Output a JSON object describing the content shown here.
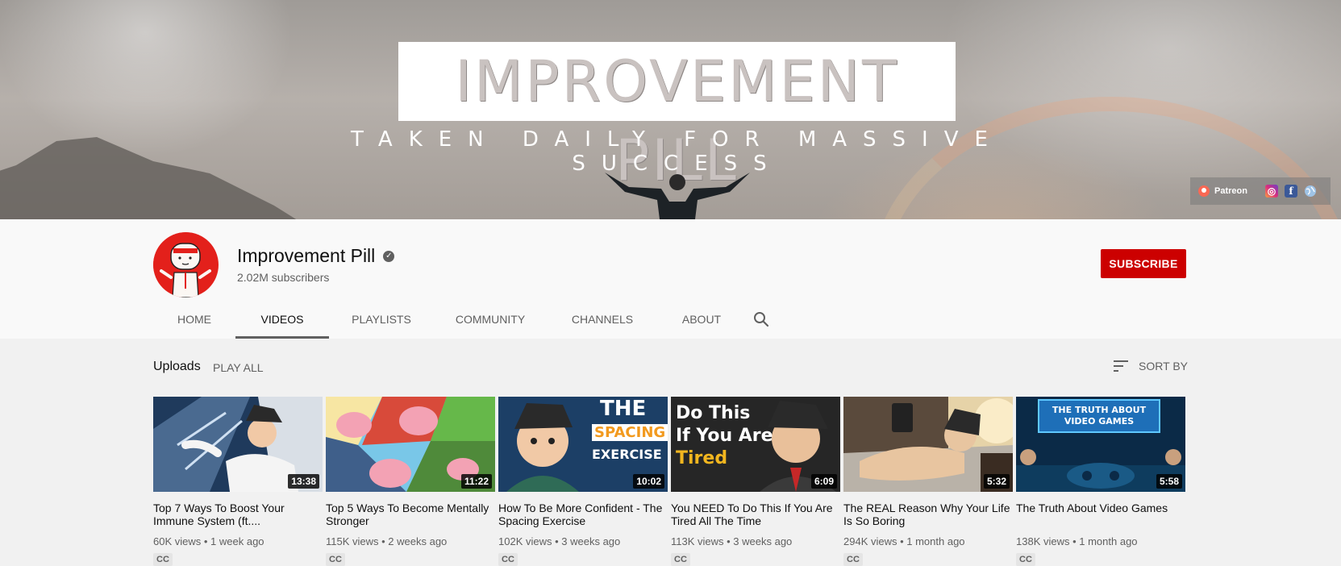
{
  "banner": {
    "title": "IMPROVEMENT PILL",
    "tagline": "TAKEN DAILY FOR MASSIVE SUCCESS",
    "links": {
      "patreon_label": "Patreon",
      "icons": [
        "patreon-icon",
        "instagram-icon",
        "facebook-icon",
        "website-icon"
      ]
    }
  },
  "channel": {
    "name": "Improvement Pill",
    "subscribers": "2.02M subscribers",
    "subscribe_label": "SUBSCRIBE",
    "brand_color": "#cc0000"
  },
  "tabs": [
    {
      "label": "HOME",
      "active": false
    },
    {
      "label": "VIDEOS",
      "active": true
    },
    {
      "label": "PLAYLISTS",
      "active": false
    },
    {
      "label": "COMMUNITY",
      "active": false
    },
    {
      "label": "CHANNELS",
      "active": false
    },
    {
      "label": "ABOUT",
      "active": false
    }
  ],
  "uploads": {
    "title": "Uploads",
    "play_all": "PLAY ALL",
    "sort_by": "SORT BY"
  },
  "videos": [
    {
      "title": "Top 7 Ways To Boost Your Immune System (ft....",
      "views": "60K views",
      "age": "1 week ago",
      "duration": "13:38",
      "badge": "CC"
    },
    {
      "title": "Top 5 Ways To Become Mentally Stronger",
      "views": "115K views",
      "age": "2 weeks ago",
      "duration": "11:22",
      "badge": "CC"
    },
    {
      "title": "How To Be More Confident - The Spacing Exercise",
      "views": "102K views",
      "age": "3 weeks ago",
      "duration": "10:02",
      "badge": "CC",
      "thumb_text": [
        "THE",
        "SPACING",
        "EXERCISE"
      ]
    },
    {
      "title": "You NEED To Do This If You Are Tired All The Time",
      "views": "113K views",
      "age": "3 weeks ago",
      "duration": "6:09",
      "badge": "CC",
      "thumb_text": [
        "Do This",
        "If You Are",
        "Tired"
      ]
    },
    {
      "title": "The REAL Reason Why Your Life Is So Boring",
      "views": "294K views",
      "age": "1 month ago",
      "duration": "5:32",
      "badge": "CC"
    },
    {
      "title": "The Truth About Video Games",
      "views": "138K views",
      "age": "1 month ago",
      "duration": "5:58",
      "badge": "CC",
      "thumb_text": [
        "THE TRUTH ABOUT",
        "VIDEO GAMES"
      ]
    }
  ]
}
